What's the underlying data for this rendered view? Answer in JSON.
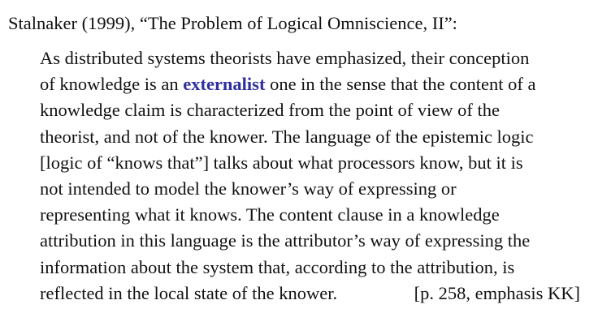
{
  "heading": "Stalnaker (1999), “The Problem of Logical Omniscience, II”:",
  "quote": {
    "lines": [
      [
        "As distributed systems theorists have emphasized, their conception"
      ],
      [
        "of knowledge is an ",
        "externalist",
        " one in the sense that the content of a"
      ],
      [
        "knowledge claim is characterized from the point of view of the"
      ],
      [
        "theorist, and not of the knower.  The language of the epistemic logic"
      ],
      [
        "[logic of “knows that”] talks about what processors know, but it is"
      ],
      [
        "not intended to model the knower’s way of expressing or"
      ],
      [
        "representing what it knows.  The content clause in a knowledge"
      ],
      [
        "attribution in this language is the attributor’s way of expressing the"
      ],
      [
        "information about the system that, according to the attribution, is"
      ]
    ],
    "last_line_text": "reflected in the local state of the knower.",
    "citation": "[p. 258, emphasis KK]"
  },
  "colors": {
    "text": "#111111",
    "emphasis": "#2e2f9e",
    "background": "#ffffff"
  }
}
